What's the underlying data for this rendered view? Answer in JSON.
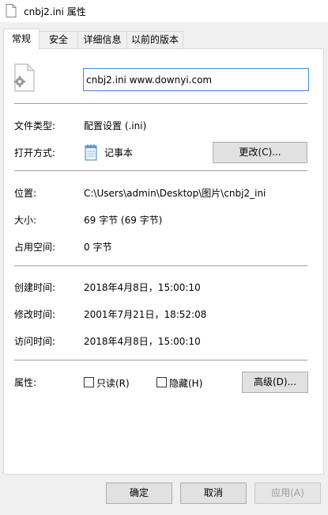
{
  "window": {
    "title": "cnbj2.ini 属性"
  },
  "tabs": [
    {
      "label": "常规",
      "active": true
    },
    {
      "label": "安全",
      "active": false
    },
    {
      "label": "详细信息",
      "active": false
    },
    {
      "label": "以前的版本",
      "active": false
    }
  ],
  "file": {
    "name": "cnbj2.ini www.downyi.com",
    "icon": "settings-file-icon"
  },
  "type": {
    "label": "文件类型:",
    "value": "配置设置 (.ini)"
  },
  "opens_with": {
    "label": "打开方式:",
    "app": "记事本",
    "app_icon": "notepad-icon",
    "change_button": "更改(C)..."
  },
  "location": {
    "label": "位置:",
    "value": "C:\\Users\\admin\\Desktop\\图片\\cnbj2_ini"
  },
  "size": {
    "label": "大小:",
    "value": "69 字节 (69 字节)"
  },
  "size_on_disk": {
    "label": "占用空间:",
    "value": "0 字节"
  },
  "created": {
    "label": "创建时间:",
    "value": "2018年4月8日，15:00:10"
  },
  "modified": {
    "label": "修改时间:",
    "value": "2001年7月21日，18:52:08"
  },
  "accessed": {
    "label": "访问时间:",
    "value": "2018年4月8日，15:00:10"
  },
  "attributes": {
    "label": "属性:",
    "readonly_label": "只读(R)",
    "hidden_label": "隐藏(H)",
    "readonly_checked": false,
    "hidden_checked": false,
    "advanced_button": "高级(D)..."
  },
  "footer": {
    "ok": "确定",
    "cancel": "取消",
    "apply": "应用(A)"
  },
  "colors": {
    "input_border": "#3c8ad8",
    "disabled_text": "#9a9a9a"
  }
}
